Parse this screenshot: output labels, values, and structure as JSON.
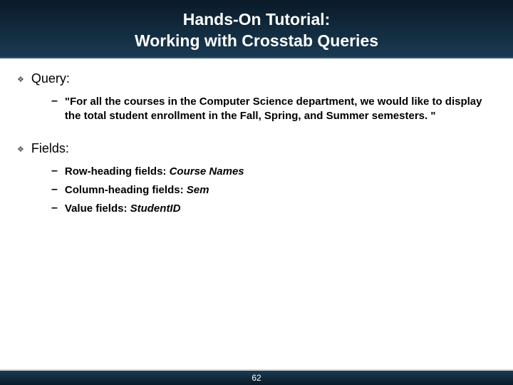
{
  "header": {
    "line1": "Hands-On Tutorial:",
    "line2": "Working with Crosstab Queries"
  },
  "sections": [
    {
      "heading": "Query:",
      "items": [
        {
          "prefix": "",
          "text": "\"For all the courses in the Computer Science department, we would like to display the total student enrollment in the Fall, Spring, and Summer semesters. \"",
          "italic": ""
        }
      ]
    },
    {
      "heading": "Fields:",
      "items": [
        {
          "prefix": "Row-heading fields: ",
          "italic": "Course Names"
        },
        {
          "prefix": "Column-heading fields: ",
          "italic": "Sem"
        },
        {
          "prefix": "Value fields: ",
          "italic": "StudentID"
        }
      ]
    }
  ],
  "footer": {
    "page": "62"
  }
}
